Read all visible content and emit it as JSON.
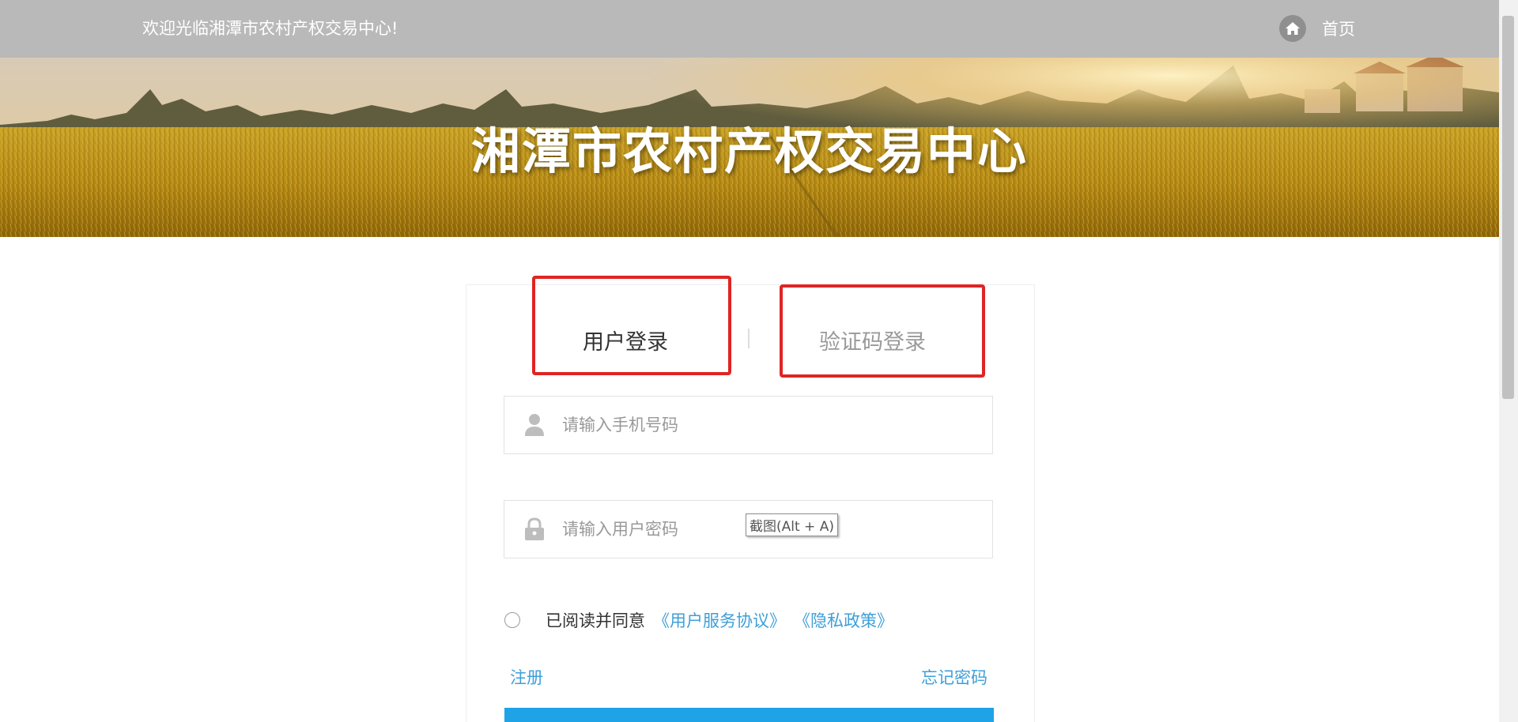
{
  "topbar": {
    "welcome_text": "欢迎光临湘潭市农村产权交易中心!",
    "home_label": "首页"
  },
  "banner": {
    "title": "湘潭市农村产权交易中心"
  },
  "login": {
    "tabs": [
      {
        "label": "用户登录",
        "active": true
      },
      {
        "label": "验证码登录",
        "active": false
      }
    ],
    "phone_placeholder": "请输入手机号码",
    "password_placeholder": "请输入用户密码",
    "screenshot_tooltip": "截图(Alt + A)",
    "agree_text": "已阅读并同意",
    "service_agreement": "《用户服务协议》",
    "privacy_policy": "《隐私政策》",
    "register_link": "注册",
    "forgot_password_link": "忘记密码"
  },
  "colors": {
    "highlight_box": "#e02424",
    "link": "#3e9fd9",
    "primary_button": "#1ea3e6",
    "topbar_bg": "#b9b9b9"
  },
  "icons": [
    "home-icon",
    "user-icon",
    "lock-icon"
  ]
}
